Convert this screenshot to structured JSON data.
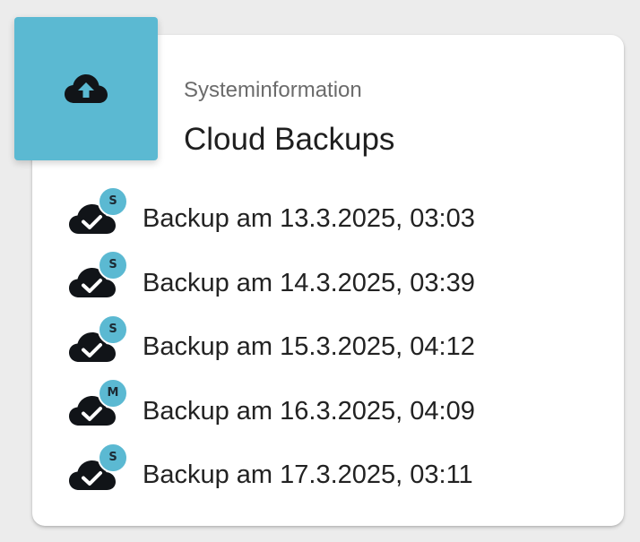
{
  "header": {
    "icon": "cloud-upload-icon",
    "subtitle": "Systeminformation",
    "title": "Cloud Backups",
    "accent_color": "#5bb9d2"
  },
  "backups": [
    {
      "label": "Backup am 13.3.2025, 03:03",
      "badge": "S",
      "icon": "cloud-check-icon"
    },
    {
      "label": "Backup am 14.3.2025, 03:39",
      "badge": "S",
      "icon": "cloud-check-icon"
    },
    {
      "label": "Backup am 15.3.2025, 04:12",
      "badge": "S",
      "icon": "cloud-check-icon"
    },
    {
      "label": "Backup am 16.3.2025, 04:09",
      "badge": "M",
      "icon": "cloud-check-icon"
    },
    {
      "label": "Backup am 17.3.2025, 03:11",
      "badge": "S",
      "icon": "cloud-check-icon"
    }
  ]
}
